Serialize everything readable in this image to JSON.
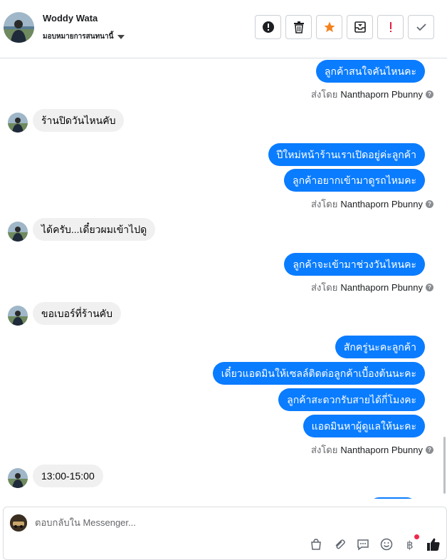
{
  "header": {
    "contact_name": "Woddy Wata",
    "assign_label": "มอบหมายการสนทนานี้",
    "toolbar": [
      {
        "name": "spam-button",
        "icon": "alert-circle-icon"
      },
      {
        "name": "delete-button",
        "icon": "trash-icon"
      },
      {
        "name": "star-button",
        "icon": "star-icon"
      },
      {
        "name": "archive-button",
        "icon": "archive-icon"
      },
      {
        "name": "mark-important-button",
        "icon": "exclamation-icon"
      },
      {
        "name": "mark-done-button",
        "icon": "check-icon"
      }
    ]
  },
  "messages": {
    "m1": "ลูกค้าสนใจคันไหนคะ",
    "m2": "ร้านปิดวันไหนคับ",
    "m3": "ปีใหม่หน้าร้านเราเปิดอยู่ค่ะลูกค้า",
    "m4": "ลูกค้าอยากเข้ามาดูรถไหมคะ",
    "m5": "ได้ครับ...เดี๋ยวผมเข้าไปดู",
    "m6": "ลูกค้าจะเข้ามาช่วงวันไหนคะ",
    "m7": "ขอเบอร์ที่ร้านคับ",
    "m8": "สักครู่นะคะลูกค้า",
    "m9": "เดี๋ยวแอดมินให้เซลล์ติดต่อลูกค้าเบื้องต้นนะคะ",
    "m10": "ลูกค้าสะดวกรับสายได้กี่โมงคะ",
    "m11": "แอดมินหาผู้ดูแลให้นะคะ",
    "m12": "13:00-15:00"
  },
  "sent_by": {
    "prefix": "ส่งโดย",
    "sender": "Nanthaporn Pbunny"
  },
  "composer": {
    "placeholder": "ตอบกลับใน Messenger...",
    "tools": [
      "shop-icon",
      "attachment-icon",
      "saved-reply-icon",
      "emoji-icon",
      "payment-icon",
      "like-icon"
    ]
  },
  "colors": {
    "outgoing_bubble": "#0a7cff",
    "incoming_bubble": "#f0f0f0",
    "star": "#f5821f",
    "alert_red": "#e41e3f"
  }
}
